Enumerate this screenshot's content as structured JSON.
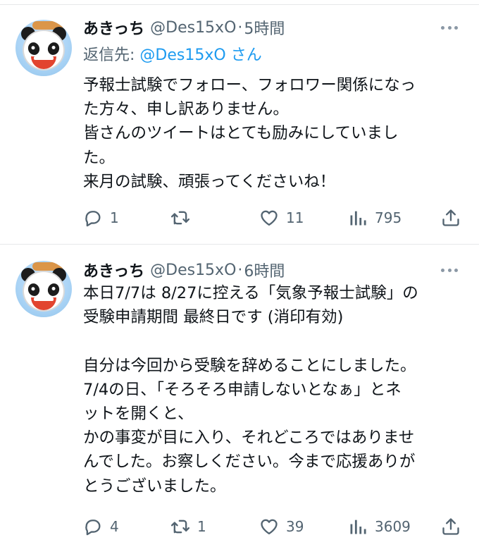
{
  "tweets": [
    {
      "author": {
        "name": "あきっち",
        "handle": "@Des15xO",
        "dot": "·",
        "time": "5時間"
      },
      "reply": {
        "prefix": "返信先: ",
        "link": "@Des15xO",
        "suffix": "さん"
      },
      "lines": [
        "予報士試験でフォロー、フォロワー関係になっ",
        "た方々、申し訳ありません。",
        "皆さんのツイートはとても励みにしていまし",
        "た。",
        "来月の試験、頑張ってくださいね！"
      ],
      "stats": {
        "replies": "1",
        "retweets": "",
        "likes": "11",
        "views": "795"
      }
    },
    {
      "author": {
        "name": "あきっち",
        "handle": "@Des15xO",
        "dot": "·",
        "time": "6時間"
      },
      "lines": [
        "本日7/7は 8/27に控える「気象予報士試験」の",
        "受験申請期間 最終日です (消印有効)",
        "",
        "自分は今回から受験を辞めることにしました。",
        "7/4の日、「そろそろ申請しないとなぁ」とネ",
        "ットを開くと、",
        "かの事変が目に入り、それどころではありませ",
        "んでした。お察しください。今まで応援ありが",
        "とうございました。"
      ],
      "stats": {
        "replies": "4",
        "retweets": "1",
        "likes": "39",
        "views": "3609"
      }
    }
  ],
  "icons": {
    "reply": "reply-bubble-icon",
    "retweet": "retweet-arrows-icon",
    "like": "heart-icon",
    "views": "bar-chart-icon",
    "share": "share-upload-icon",
    "more": "more-dots-icon"
  },
  "colors": {
    "text": "#0f1419",
    "muted": "#536471",
    "link": "#1d9bf0",
    "divider": "#e6e8ea"
  }
}
